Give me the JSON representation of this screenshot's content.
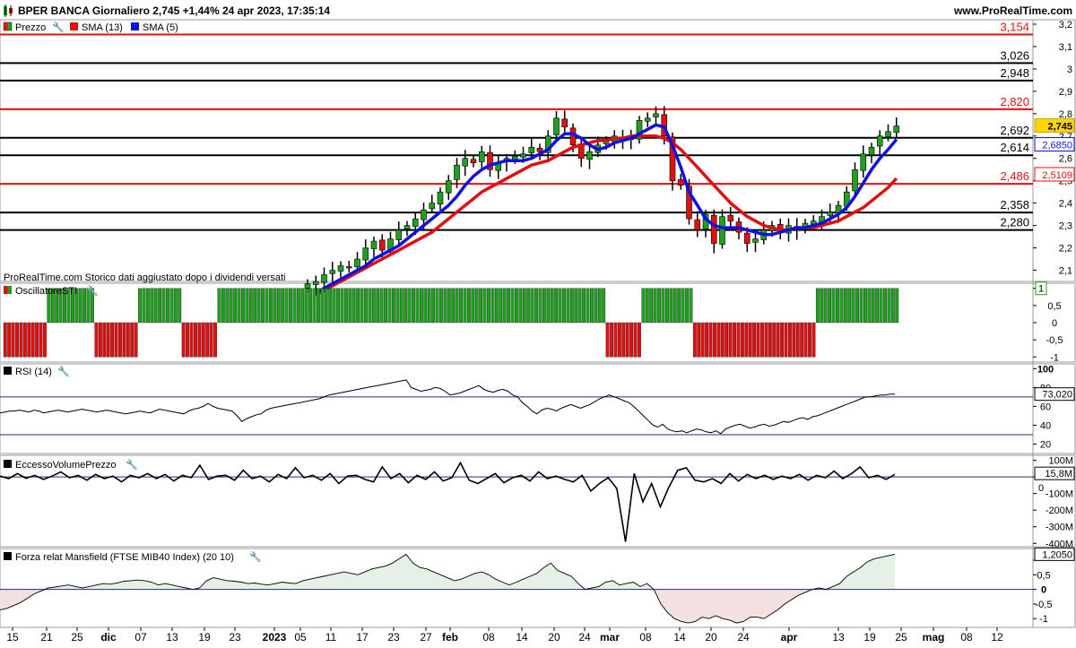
{
  "header": {
    "title": "BPER BANCA Giornaliero 2,745 +1,44% 24 apr 2023, 17:35:14",
    "site": "www.ProRealTime.com"
  },
  "panels": {
    "price": {
      "legend": [
        "Prezzo",
        "SMA (13)",
        "SMA (5)"
      ],
      "note": "ProRealTime.com Storico dati aggiustato dopo i dividendi versati",
      "price_label": "2,745",
      "sma5_label": "2,6850",
      "sma13_label": "2,5109"
    },
    "sti": {
      "legend": "OscillatoreSTI",
      "value_label": "1"
    },
    "rsi": {
      "legend": "RSI (14)",
      "value_label": "73,020"
    },
    "evp": {
      "legend": "EccessoVolumePrezzo",
      "value_label": "15,8M",
      "zero_label": "0"
    },
    "mansfield": {
      "legend": "Forza relat Mansfield (FTSE MIB40 Index) (20 10)",
      "value_label": "1,2050"
    }
  },
  "colors": {
    "bull": "#1fa01f",
    "bear": "#e01010",
    "sma5": "#1010e0",
    "sma13": "#e01010",
    "red_level": "#e01010",
    "black_level": "#000000",
    "label_price_bg": "#ffd400",
    "mansfield_pos": "#e4f1e4",
    "mansfield_neg": "#f3e0e0"
  },
  "chart_data": [
    {
      "type": "candlestick",
      "title": "BPER BANCA Giornaliero",
      "ylim": [
        2.05,
        3.22
      ],
      "y_ticks": [
        2.1,
        2.2,
        2.3,
        2.4,
        2.5,
        2.6,
        2.7,
        2.8,
        2.9,
        3,
        3.1,
        3.2
      ],
      "y_tick_labels": [
        "2,1",
        "2,2",
        "2,3",
        "2,4",
        "2,5",
        "2,6",
        "2,7",
        "2,8",
        "2,9",
        "3",
        "3,1",
        "3,2"
      ],
      "levels": [
        {
          "value": 3.154,
          "label": "3,154",
          "color": "red"
        },
        {
          "value": 3.026,
          "label": "3,026",
          "color": "black"
        },
        {
          "value": 2.948,
          "label": "2,948",
          "color": "black"
        },
        {
          "value": 2.82,
          "label": "2,820",
          "color": "red"
        },
        {
          "value": 2.692,
          "label": "2,692",
          "color": "black"
        },
        {
          "value": 2.614,
          "label": "2,614",
          "color": "black"
        },
        {
          "value": 2.486,
          "label": "2,486",
          "color": "red"
        },
        {
          "value": 2.358,
          "label": "2,358",
          "color": "black"
        },
        {
          "value": 2.28,
          "label": "2,280",
          "color": "black"
        }
      ],
      "first_candle_index": 12,
      "closes": [
        2.04,
        2.05,
        2.08,
        2.1,
        2.12,
        2.11,
        2.15,
        2.2,
        2.23,
        2.19,
        2.24,
        2.28,
        2.3,
        2.33,
        2.37,
        2.4,
        2.45,
        2.5,
        2.57,
        2.6,
        2.58,
        2.63,
        2.55,
        2.58,
        2.6,
        2.61,
        2.62,
        2.65,
        2.63,
        2.7,
        2.78,
        2.74,
        2.66,
        2.6,
        2.63,
        2.66,
        2.68,
        2.7,
        2.68,
        2.69,
        2.77,
        2.78,
        2.8,
        2.7,
        2.5,
        2.48,
        2.33,
        2.28,
        2.35,
        2.22,
        2.34,
        2.32,
        2.27,
        2.22,
        2.24,
        2.28,
        2.3,
        2.27,
        2.3,
        2.28,
        2.31,
        2.32,
        2.34,
        2.36,
        2.39,
        2.45,
        2.55,
        2.62,
        2.65,
        2.7,
        2.72,
        2.745
      ],
      "sma5": [
        2.0,
        2.02,
        2.04,
        2.06,
        2.08,
        2.1,
        2.12,
        2.15,
        2.17,
        2.19,
        2.21,
        2.24,
        2.27,
        2.3,
        2.33,
        2.36,
        2.39,
        2.43,
        2.48,
        2.52,
        2.55,
        2.57,
        2.58,
        2.59,
        2.59,
        2.59,
        2.6,
        2.62,
        2.64,
        2.68,
        2.71,
        2.71,
        2.69,
        2.66,
        2.64,
        2.65,
        2.67,
        2.68,
        2.69,
        2.71,
        2.73,
        2.75,
        2.74,
        2.66,
        2.56,
        2.45,
        2.39,
        2.33,
        2.3,
        2.29,
        2.29,
        2.29,
        2.28,
        2.27,
        2.26,
        2.26,
        2.27,
        2.28,
        2.29,
        2.29,
        2.3,
        2.31,
        2.33,
        2.35,
        2.38,
        2.43,
        2.49,
        2.55,
        2.6,
        2.64,
        2.685
      ],
      "sma13": [
        1.99,
        2.01,
        2.03,
        2.05,
        2.07,
        2.09,
        2.11,
        2.13,
        2.15,
        2.17,
        2.19,
        2.21,
        2.23,
        2.25,
        2.27,
        2.3,
        2.33,
        2.36,
        2.39,
        2.42,
        2.45,
        2.47,
        2.49,
        2.51,
        2.53,
        2.55,
        2.57,
        2.58,
        2.59,
        2.61,
        2.63,
        2.65,
        2.66,
        2.67,
        2.68,
        2.68,
        2.69,
        2.69,
        2.7,
        2.7,
        2.7,
        2.7,
        2.69,
        2.67,
        2.64,
        2.6,
        2.56,
        2.52,
        2.48,
        2.44,
        2.4,
        2.37,
        2.34,
        2.32,
        2.3,
        2.29,
        2.28,
        2.28,
        2.29,
        2.29,
        2.29,
        2.3,
        2.31,
        2.32,
        2.34,
        2.36,
        2.38,
        2.41,
        2.44,
        2.47,
        2.5109
      ]
    },
    {
      "type": "bar",
      "title": "OscillatoreSTI",
      "ylim": [
        -1.15,
        1.15
      ],
      "y_tick_labels": [
        "1",
        "0,5",
        "0",
        "-0,5",
        "-1"
      ],
      "signals": [
        -1,
        -1,
        -1,
        -1,
        -1,
        -1,
        -1,
        -1,
        -1,
        -1,
        -1,
        1,
        1,
        1,
        1,
        1,
        1,
        1,
        1,
        1,
        1,
        1,
        1,
        -1,
        -1,
        -1,
        -1,
        -1,
        -1,
        -1,
        -1,
        -1,
        -1,
        -1,
        1,
        1,
        1,
        1,
        1,
        1,
        1,
        1,
        1,
        1,
        1,
        -1,
        -1,
        -1,
        -1,
        -1,
        -1,
        -1,
        -1,
        -1,
        1,
        1,
        1,
        1,
        1,
        1,
        1,
        1,
        1,
        1,
        1,
        1,
        1,
        1,
        1,
        1,
        1,
        1,
        1,
        1,
        1,
        1,
        1,
        1,
        1,
        1,
        1,
        1,
        1,
        1,
        1,
        1,
        1,
        1,
        1,
        1,
        1,
        1,
        1,
        1,
        1,
        1,
        1,
        1,
        1,
        1,
        1,
        1,
        1,
        1,
        1,
        1,
        1,
        1,
        1,
        1,
        1,
        1,
        1,
        1,
        1,
        1,
        1,
        1,
        1,
        1,
        1,
        1,
        1,
        1,
        1,
        1,
        1,
        1,
        1,
        1,
        1,
        1,
        1,
        1,
        1,
        1,
        1,
        1,
        1,
        1,
        1,
        1,
        1,
        1,
        1,
        1,
        1,
        1,
        1,
        1,
        1,
        1,
        -1,
        -1,
        -1,
        -1,
        -1,
        -1,
        -1,
        -1,
        -1,
        1,
        1,
        1,
        1,
        1,
        1,
        1,
        1,
        1,
        1,
        1,
        1,
        1,
        -1,
        -1,
        -1,
        -1,
        -1,
        -1,
        -1,
        -1,
        -1,
        -1,
        -1,
        -1,
        -1,
        -1,
        -1,
        -1,
        -1,
        -1,
        -1,
        -1,
        -1,
        -1,
        -1,
        -1,
        -1,
        -1,
        -1,
        -1,
        -1,
        -1,
        -1,
        1,
        1,
        1,
        1,
        1,
        1,
        1,
        1,
        1,
        1,
        1,
        1,
        1,
        1,
        1,
        1,
        1,
        1,
        1,
        1,
        1,
        1,
        1,
        1,
        1,
        1,
        1,
        1,
        1,
        1,
        1
      ]
    },
    {
      "type": "line",
      "title": "RSI (14)",
      "ylim": [
        10,
        105
      ],
      "y_tick_labels": [
        "100",
        "80",
        "60",
        "40",
        "20"
      ],
      "levels": [
        70,
        30
      ],
      "values": [
        53,
        54,
        55,
        55,
        56,
        55,
        54,
        56,
        55,
        53,
        54,
        55,
        56,
        55,
        54,
        55,
        56,
        57,
        56,
        55,
        54,
        55,
        56,
        55,
        54,
        53,
        52,
        53,
        54,
        55,
        54,
        53,
        55,
        57,
        56,
        55,
        54,
        53,
        52,
        55,
        57,
        58,
        60,
        63,
        60,
        58,
        57,
        56,
        55,
        50,
        44,
        47,
        49,
        51,
        52,
        56,
        58,
        59,
        60,
        61,
        62,
        63,
        64,
        65,
        66,
        67,
        68,
        70,
        72,
        73,
        74,
        75,
        76,
        77,
        78,
        79,
        80,
        81,
        82,
        83,
        84,
        85,
        86,
        87,
        88,
        80,
        78,
        76,
        77,
        78,
        80,
        79,
        76,
        72,
        73,
        74,
        76,
        78,
        80,
        82,
        78,
        76,
        75,
        77,
        78,
        76,
        72,
        70,
        64,
        60,
        55,
        52,
        56,
        58,
        57,
        55,
        58,
        60,
        62,
        60,
        58,
        60,
        62,
        65,
        68,
        70,
        72,
        70,
        68,
        66,
        64,
        60,
        55,
        50,
        45,
        40,
        38,
        41,
        36,
        34,
        33,
        34,
        32,
        34,
        36,
        35,
        33,
        32,
        34,
        31,
        36,
        38,
        40,
        41,
        39,
        37,
        38,
        40,
        41,
        39,
        40,
        42,
        44,
        43,
        45,
        47,
        48,
        46,
        49,
        50,
        52,
        54,
        56,
        58,
        60,
        62,
        64,
        66,
        68,
        70,
        70,
        71,
        72,
        72,
        73,
        73.02
      ]
    },
    {
      "type": "line",
      "title": "EccessoVolumePrezzo",
      "ylim": [
        -420,
        130
      ],
      "y_tick_labels": [
        "100M",
        "0",
        "-100M",
        "-200M",
        "-300M",
        "-400M"
      ],
      "values": [
        5,
        -10,
        20,
        -8,
        10,
        -15,
        5,
        30,
        -5,
        10,
        -20,
        15,
        -10,
        5,
        -30,
        10,
        -5,
        20,
        -10,
        15,
        -25,
        10,
        -5,
        70,
        -15,
        5,
        10,
        -20,
        40,
        -10,
        5,
        -30,
        15,
        -10,
        55,
        -5,
        10,
        -20,
        20,
        -40,
        5,
        10,
        -15,
        -30,
        60,
        -10,
        20,
        -35,
        10,
        -15,
        30,
        -25,
        -5,
        85,
        -20,
        -40,
        -10,
        20,
        -35,
        -5,
        10,
        -25,
        30,
        -10,
        5,
        -15,
        -30,
        10,
        -85,
        -40,
        -5,
        -70,
        -390,
        20,
        -150,
        -40,
        -180,
        -60,
        40,
        55,
        -20,
        -30,
        -10,
        -40,
        20,
        -25,
        15,
        -10,
        10,
        -15,
        5,
        -10,
        15,
        -20,
        10,
        -5,
        35,
        -10,
        20,
        60,
        -5,
        10,
        -15,
        15
      ],
      "last_label": "15,8M"
    },
    {
      "type": "area",
      "title": "Forza relat Mansfield (FTSE MIB40 Index) (20 10)",
      "ylim": [
        -1.3,
        1.4
      ],
      "y_tick_labels": [
        "1",
        "0,5",
        "0",
        "-0,5",
        "-1"
      ],
      "values": [
        -0.7,
        -0.65,
        -0.55,
        -0.45,
        -0.3,
        -0.15,
        -0.05,
        0.05,
        0.08,
        0.12,
        0.15,
        0.1,
        0.05,
        0.1,
        0.15,
        0.2,
        0.18,
        0.22,
        0.28,
        0.3,
        0.32,
        0.3,
        0.25,
        0.15,
        0.2,
        0.15,
        0.1,
        0.05,
        0.0,
        0.05,
        0.3,
        0.4,
        0.35,
        0.3,
        0.28,
        0.25,
        0.2,
        0.22,
        0.18,
        0.15,
        0.2,
        0.25,
        0.22,
        0.2,
        0.3,
        0.35,
        0.4,
        0.45,
        0.5,
        0.55,
        0.6,
        0.55,
        0.5,
        0.6,
        0.7,
        0.75,
        0.8,
        0.9,
        1.05,
        1.2,
        0.9,
        0.75,
        0.7,
        0.6,
        0.5,
        0.4,
        0.3,
        0.35,
        0.45,
        0.55,
        0.6,
        0.5,
        0.35,
        0.25,
        0.15,
        0.25,
        0.35,
        0.45,
        0.55,
        0.75,
        0.9,
        0.65,
        0.55,
        0.45,
        0.2,
        0.0,
        0.05,
        0.1,
        0.25,
        0.3,
        0.15,
        0.2,
        0.25,
        0.1,
        0.2,
        0.0,
        -0.5,
        -0.8,
        -1.0,
        -1.1,
        -1.15,
        -1.1,
        -0.95,
        -1.0,
        -0.9,
        -1.0,
        -1.05,
        -1.15,
        -1.1,
        -0.95,
        -0.95,
        -1.0,
        -0.85,
        -0.7,
        -0.5,
        -0.35,
        -0.2,
        -0.1,
        0.0,
        0.05,
        0.0,
        0.1,
        0.2,
        0.45,
        0.6,
        0.75,
        0.95,
        1.05,
        1.1,
        1.15,
        1.205
      ]
    }
  ],
  "x_axis": {
    "labels": [
      "15",
      "21",
      "25",
      "dic",
      "07",
      "13",
      "19",
      "23",
      "2023",
      "05",
      "11",
      "17",
      "23",
      "27",
      "feb",
      "08",
      "14",
      "20",
      "24",
      "mar",
      "08",
      "14",
      "20",
      "24",
      "apr",
      "13",
      "19",
      "25",
      "mag",
      "08",
      "12"
    ],
    "bold": [
      "dic",
      "2023",
      "feb",
      "mar",
      "apr",
      "mag"
    ]
  }
}
